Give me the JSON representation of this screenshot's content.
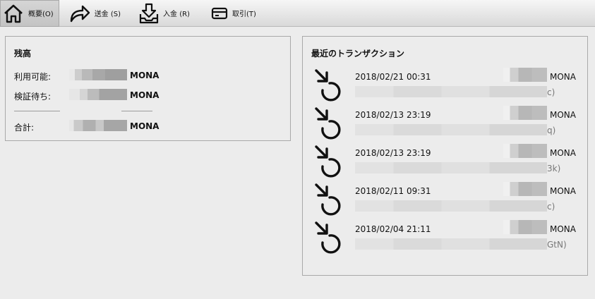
{
  "toolbar": {
    "items": [
      {
        "label": "概要(O)",
        "icon": "home-icon",
        "active": true
      },
      {
        "label": "送金 (S)",
        "icon": "send-arrow-icon",
        "active": false
      },
      {
        "label": "入金 (R)",
        "icon": "receive-tray-icon",
        "active": false
      },
      {
        "label": "取引(T)",
        "icon": "card-icon",
        "active": false
      }
    ]
  },
  "balance": {
    "title": "残高",
    "available_label": "利用可能:",
    "pending_label": "検証待ち:",
    "total_label": "合計:",
    "unit": "MONA"
  },
  "transactions": {
    "title": "最近のトランザクション",
    "unit": "MONA",
    "icon": "receive-arrow-icon",
    "items": [
      {
        "date": "2018/02/21 00:31",
        "addr_tail": "c)"
      },
      {
        "date": "2018/02/13 23:19",
        "addr_tail": "q)"
      },
      {
        "date": "2018/02/13 23:19",
        "addr_tail": "3k)"
      },
      {
        "date": "2018/02/11 09:31",
        "addr_tail": "c)"
      },
      {
        "date": "2018/02/04 21:11",
        "addr_tail": "GtN)"
      }
    ]
  },
  "colors": {
    "background": "#ececec",
    "border": "#a9a9a9",
    "text": "#111111",
    "muted": "#777777"
  }
}
